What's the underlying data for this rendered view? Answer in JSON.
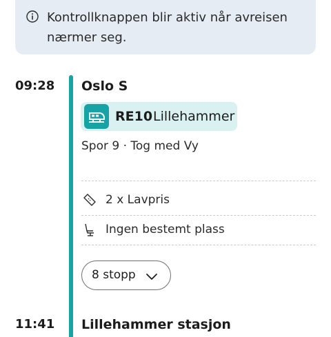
{
  "info_banner": {
    "icon": "info-circle-icon",
    "text": "Kontrollknappen blir aktiv når avreisen nærmer seg."
  },
  "departure": {
    "time": "09:28",
    "station": "Oslo S"
  },
  "route": {
    "icon": "train-icon",
    "code": "RE10",
    "destination": "Lillehammer",
    "accent_color": "#17a3a6",
    "chip_color": "#daf1f2"
  },
  "platform_info": "Spor 9 · Tog med Vy",
  "ticket": {
    "icon": "ticket-icon",
    "text": "2 x Lavpris"
  },
  "seat": {
    "icon": "seat-icon",
    "text": "Ingen bestemt plass"
  },
  "stops_button": {
    "label": "8 stopp",
    "icon": "chevron-down-icon"
  },
  "arrival": {
    "time": "11:41",
    "station": "Lillehammer stasjon"
  }
}
